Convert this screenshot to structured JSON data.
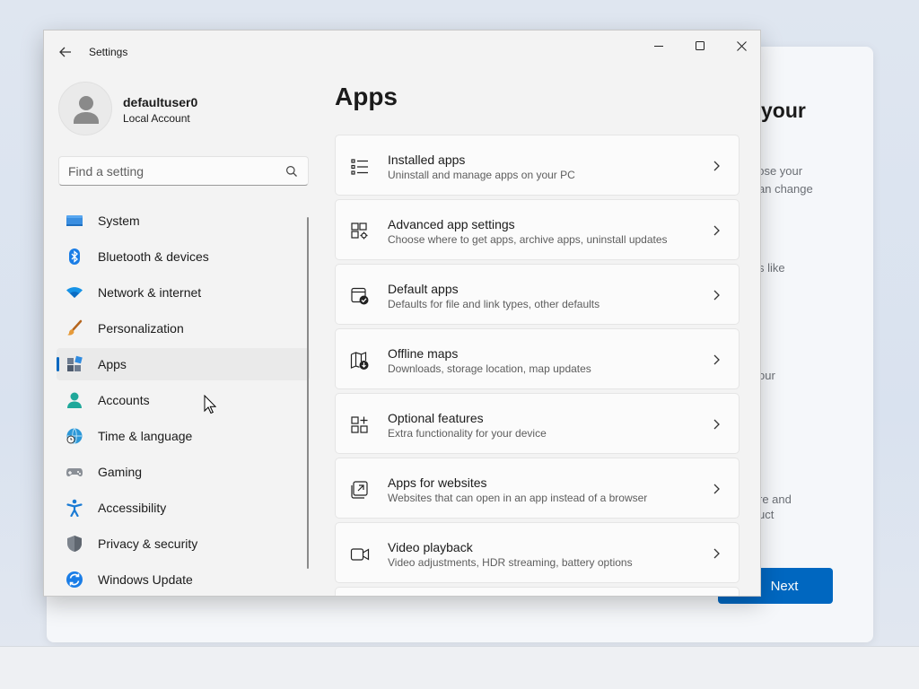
{
  "background_window": {
    "title_fragment": "your",
    "text_fragments": [
      "oose your",
      "an change",
      "s like",
      "our",
      "re and",
      "uct"
    ],
    "next_label": "Next"
  },
  "window": {
    "title": "Settings",
    "back_icon": "arrow-left-icon",
    "controls": [
      "minimize-icon",
      "maximize-icon",
      "close-icon"
    ]
  },
  "profile": {
    "username": "defaultuser0",
    "account_type": "Local Account"
  },
  "search": {
    "placeholder": "Find a setting",
    "value": ""
  },
  "nav": {
    "items": [
      {
        "label": "System",
        "icon": "system-display-icon"
      },
      {
        "label": "Bluetooth & devices",
        "icon": "bluetooth-icon"
      },
      {
        "label": "Network & internet",
        "icon": "wifi-icon"
      },
      {
        "label": "Personalization",
        "icon": "paintbrush-icon"
      },
      {
        "label": "Apps",
        "icon": "apps-icon",
        "selected": true
      },
      {
        "label": "Accounts",
        "icon": "person-icon"
      },
      {
        "label": "Time & language",
        "icon": "globe-clock-icon"
      },
      {
        "label": "Gaming",
        "icon": "gamepad-icon"
      },
      {
        "label": "Accessibility",
        "icon": "accessibility-icon"
      },
      {
        "label": "Privacy & security",
        "icon": "shield-icon"
      },
      {
        "label": "Windows Update",
        "icon": "update-icon"
      }
    ]
  },
  "main": {
    "title": "Apps",
    "cards": [
      {
        "title": "Installed apps",
        "subtitle": "Uninstall and manage apps on your PC",
        "icon": "list-icon"
      },
      {
        "title": "Advanced app settings",
        "subtitle": "Choose where to get apps, archive apps, uninstall updates",
        "icon": "app-settings-icon"
      },
      {
        "title": "Default apps",
        "subtitle": "Defaults for file and link types, other defaults",
        "icon": "default-apps-icon"
      },
      {
        "title": "Offline maps",
        "subtitle": "Downloads, storage location, map updates",
        "icon": "map-download-icon"
      },
      {
        "title": "Optional features",
        "subtitle": "Extra functionality for your device",
        "icon": "grid-add-icon"
      },
      {
        "title": "Apps for websites",
        "subtitle": "Websites that can open in an app instead of a browser",
        "icon": "open-in-app-icon"
      },
      {
        "title": "Video playback",
        "subtitle": "Video adjustments, HDR streaming, battery options",
        "icon": "video-camera-icon"
      }
    ]
  },
  "colors": {
    "accent": "#0067c0",
    "window_bg": "#f3f3f3",
    "card_bg": "#fbfbfb"
  }
}
